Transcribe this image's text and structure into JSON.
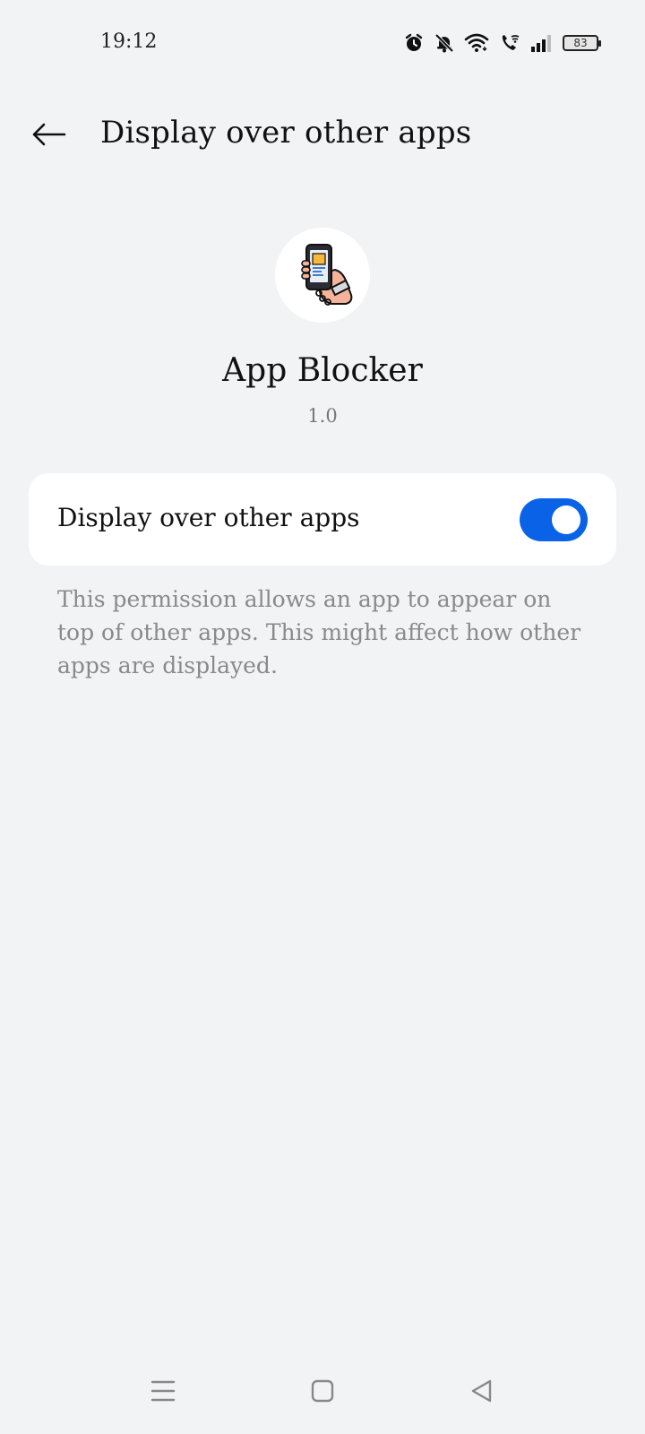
{
  "status_bar": {
    "time": "19:12",
    "battery_level": "83",
    "icons": [
      "alarm-icon",
      "bell-off-icon",
      "wifi-icon",
      "wifi-calling-icon",
      "signal-icon",
      "battery-icon"
    ]
  },
  "header": {
    "back_icon": "arrow-left-icon",
    "title": "Display over other apps"
  },
  "app": {
    "name": "App Blocker",
    "version": "1.0",
    "icon": "phone-in-hand-icon"
  },
  "setting": {
    "label": "Display over other apps",
    "enabled": true,
    "toggle_color": "#0a63e6"
  },
  "description": "This permission allows an app to appear on top of other apps. This might affect how other apps are displayed.",
  "nav_bar": {
    "buttons": [
      "recents-icon",
      "home-icon",
      "back-icon"
    ]
  },
  "colors": {
    "background": "#f2f3f5",
    "card": "#ffffff",
    "accent": "#0a63e6",
    "secondary_text": "#8a8a8a"
  }
}
